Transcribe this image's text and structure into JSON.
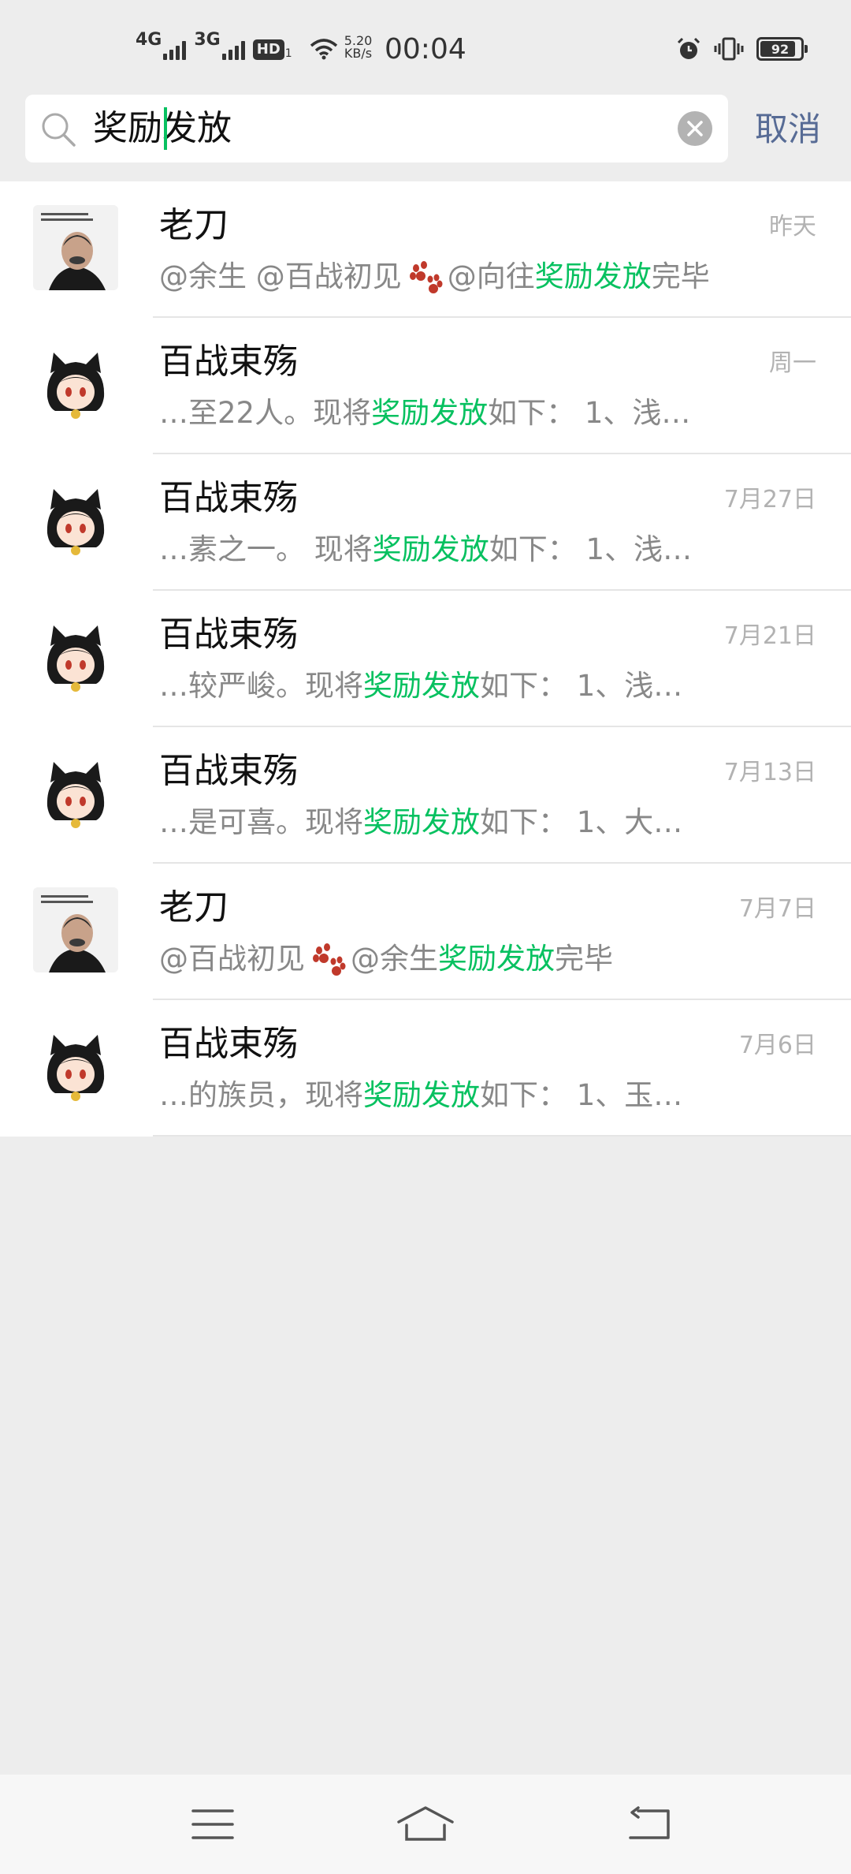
{
  "status_bar": {
    "net1": "4G",
    "net2": "3G",
    "hd": "HD",
    "hd_sub": "1",
    "speed_value": "5.20",
    "speed_unit": "KB/s",
    "time": "00:04",
    "battery": "92"
  },
  "search": {
    "query": "奖励发放",
    "cancel_label": "取消"
  },
  "results": [
    {
      "name": "老刀",
      "date": "昨天",
      "avatar": "photo",
      "pre": "@余生 @百战初见",
      "paw": true,
      "mid": "@向往 ",
      "hl": "奖励发放",
      "post": "完毕"
    },
    {
      "name": "百战束殇",
      "date": "周一",
      "avatar": "anime",
      "pre": "…至22人。现将",
      "paw": false,
      "mid": "",
      "hl": "奖励发放",
      "post": "如下：  1、浅…"
    },
    {
      "name": "百战束殇",
      "date": "7月27日",
      "avatar": "anime",
      "pre": "…素之一。 现将",
      "paw": false,
      "mid": "",
      "hl": "奖励发放",
      "post": "如下：  1、浅…"
    },
    {
      "name": "百战束殇",
      "date": "7月21日",
      "avatar": "anime",
      "pre": "…较严峻。现将",
      "paw": false,
      "mid": "",
      "hl": "奖励发放",
      "post": "如下：  1、浅…"
    },
    {
      "name": "百战束殇",
      "date": "7月13日",
      "avatar": "anime",
      "pre": "…是可喜。现将",
      "paw": false,
      "mid": "",
      "hl": "奖励发放",
      "post": "如下：  1、大…"
    },
    {
      "name": "老刀",
      "date": "7月7日",
      "avatar": "photo",
      "pre": "@百战初见",
      "paw": true,
      "mid": "@余生 ",
      "hl": "奖励发放",
      "post": "完毕"
    },
    {
      "name": "百战束殇",
      "date": "7月6日",
      "avatar": "anime",
      "pre": "…的族员，现将",
      "paw": false,
      "mid": "",
      "hl": "奖励发放",
      "post": "如下：  1、玉…"
    }
  ],
  "colors": {
    "highlight": "#07c160",
    "cancel": "#576b95",
    "paw": "#c0392b"
  },
  "icons": {
    "search": "search-icon",
    "clear": "clear-icon",
    "nav_menu": "menu-icon",
    "nav_home": "home-icon",
    "nav_back": "back-icon"
  }
}
